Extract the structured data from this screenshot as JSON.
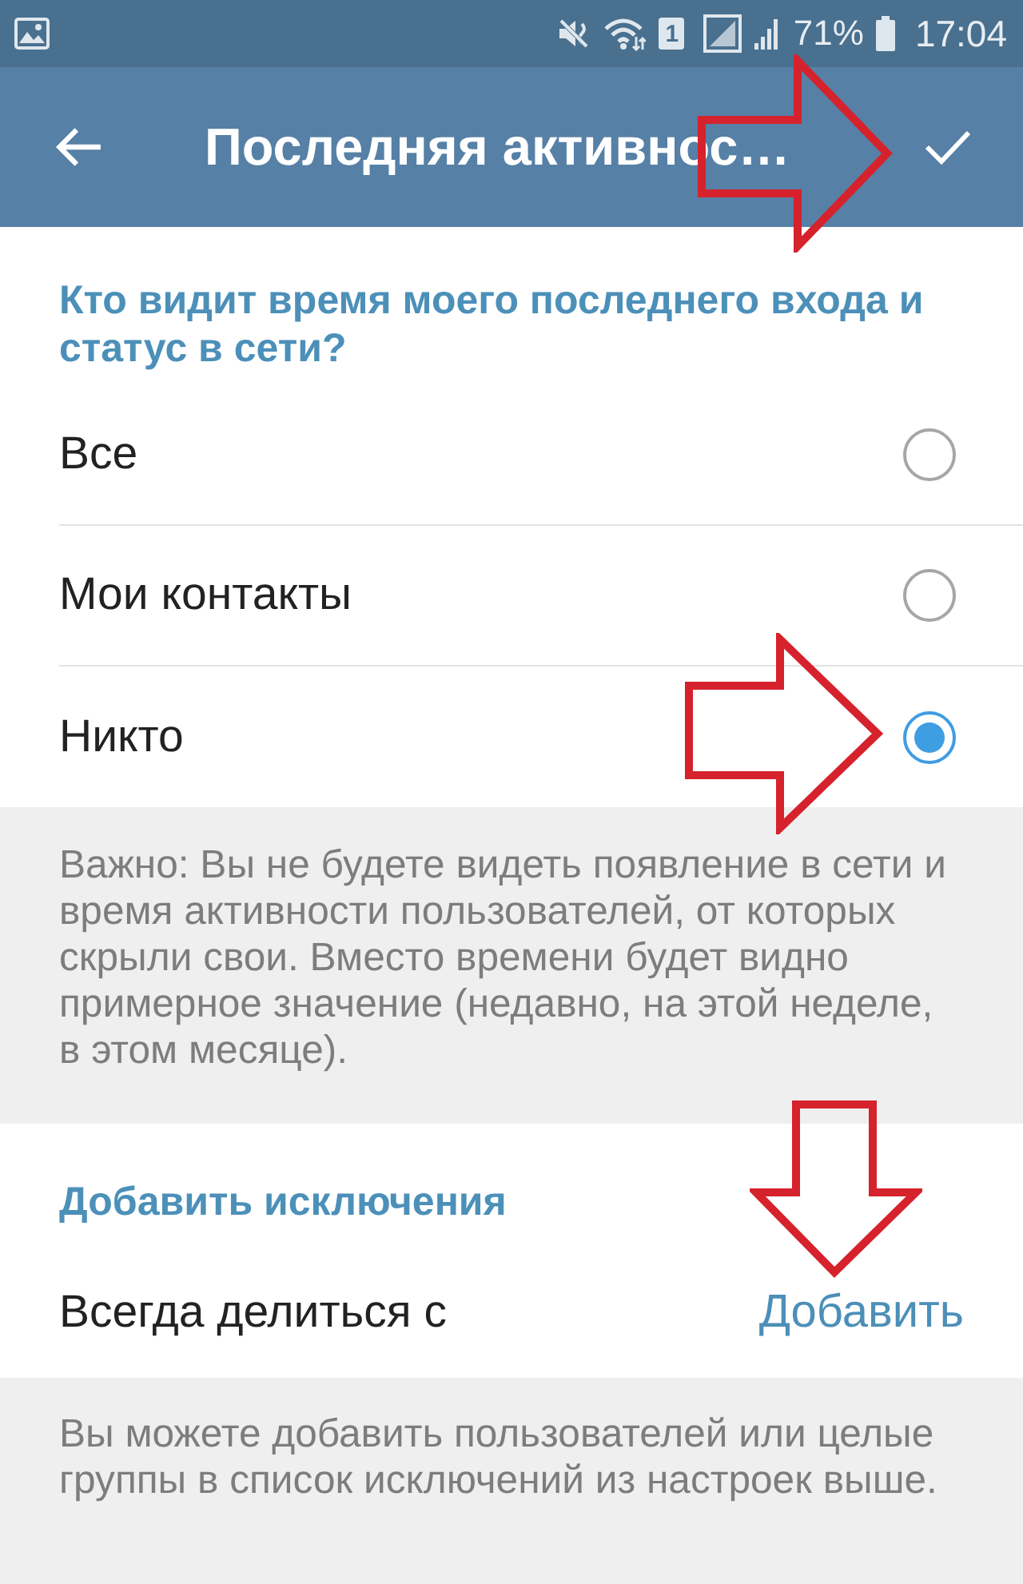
{
  "status_bar": {
    "sim_badge": "1",
    "battery": "71%",
    "time": "17:04"
  },
  "app_bar": {
    "title": "Последняя активнос…"
  },
  "privacy_section": {
    "header": "Кто видит время моего последнего входа и статус в сети?",
    "options": [
      {
        "label": "Все",
        "selected": false
      },
      {
        "label": "Мои контакты",
        "selected": false
      },
      {
        "label": "Никто",
        "selected": true
      }
    ]
  },
  "privacy_note": "Важно: Вы не будете видеть появление в сети и время активности пользователей, от которых скрыли свои. Вместо времени будет видно примерное значение (недавно, на этой неделе, в этом месяце).",
  "exceptions_section": {
    "header": "Добавить исключения",
    "rows": [
      {
        "label": "Всегда делиться с",
        "action": "Добавить"
      }
    ]
  },
  "exceptions_note": "Вы можете добавить пользователей или целые группы в список исключений из настроек выше."
}
